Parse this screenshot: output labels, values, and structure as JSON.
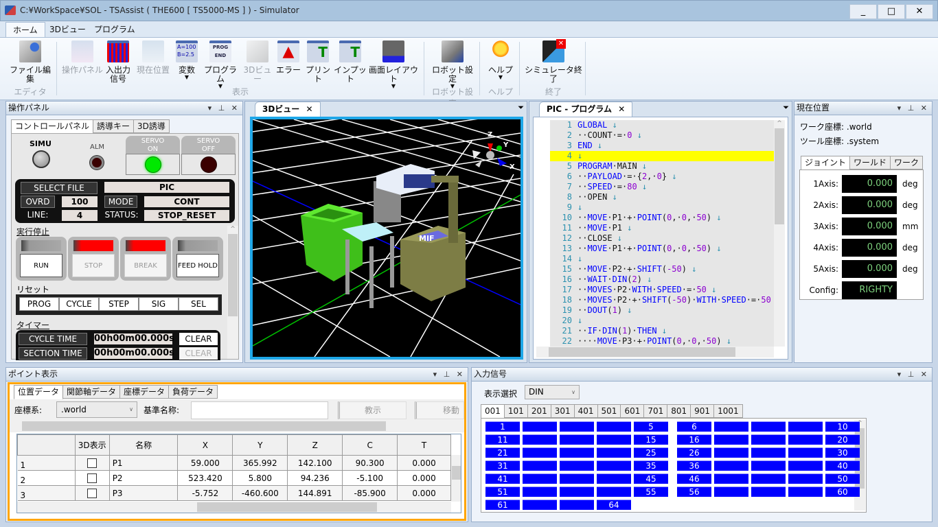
{
  "window": {
    "title": "C:¥WorkSpace¥SOL   - TSAssist ( THE600 [ TS5000-MS ] )   - Simulator",
    "controls": {
      "minimize": "_",
      "maximize": "□",
      "close": "✕"
    }
  },
  "ribbon": {
    "tabs": [
      "ホーム",
      "3Dビュー",
      "プログラム"
    ],
    "active_tab": "ホーム",
    "buttons": {
      "file_edit": "ファイル編集",
      "op_panel": "操作パネル",
      "io_signal_1": "入出力",
      "io_signal_2": "信号",
      "current_pos": "現在位置",
      "variables": "変数",
      "program": "プログラム",
      "view3d": "3Dビュー",
      "error": "エラー",
      "print": "プリント",
      "input": "インプット",
      "layout": "画面レイアウト",
      "robot_settings": "ロボット設定",
      "help": "ヘルプ",
      "sim_exit": "シミュレータ終了"
    },
    "groups": {
      "editor": "エディタ",
      "display": "表示",
      "robot_settings": "ロボット設定",
      "help": "ヘルプ",
      "exit": "終了"
    }
  },
  "control_panel": {
    "title": "操作パネル",
    "tabs": [
      "コントロールパネル",
      "誘導キー",
      "3D誘導"
    ],
    "simu_label": "SIMU",
    "alm_label": "ALM",
    "servo_on": {
      "line1": "SERVO",
      "line2": "ON",
      "lamp_color": "#00e000"
    },
    "servo_off": {
      "line1": "SERVO",
      "line2": "OFF",
      "lamp_color": "#3a0000"
    },
    "select_file_label": "SELECT FILE",
    "select_file_value": "PIC",
    "ovrd_label": "OVRD",
    "ovrd_value": "100",
    "mode_label": "MODE",
    "mode_value": "CONT",
    "line_label": "LINE:",
    "line_value": "4",
    "status_label": "STATUS:",
    "status_value": "STOP_RESET",
    "exec_stop_title": "実行停止",
    "run_buttons": [
      {
        "label": "RUN",
        "lamp": "off",
        "enabled": true
      },
      {
        "label": "STOP",
        "lamp": "red",
        "enabled": false
      },
      {
        "label": "BREAK",
        "lamp": "red",
        "enabled": false
      },
      {
        "label": "FEED HOLD",
        "lamp": "off",
        "enabled": true
      }
    ],
    "reset_title": "リセット",
    "reset_buttons": [
      "PROG",
      "CYCLE",
      "STEP",
      "SIG",
      "SEL"
    ],
    "timer_title": "タイマー",
    "cycle_time_label": "CYCLE TIME",
    "cycle_time_value": "00h00m00.000s",
    "section_time_label": "SECTION TIME",
    "section_time_value": "00h00m00.000s",
    "clear_label": "CLEAR"
  },
  "view3d": {
    "tab": "3Dビュー",
    "close": "✕",
    "overlay_label": "MIF",
    "gizmo": {
      "z": "Z",
      "y": "Y",
      "x": "X"
    }
  },
  "program": {
    "tab": "PIC - プログラム",
    "close": "✕",
    "highlight_line": 4,
    "lines": [
      [
        {
          "t": "GLOBAL",
          "c": "kw"
        },
        {
          "t": " ↓",
          "c": "ret"
        }
      ],
      [
        {
          "t": "··COUNT·=·",
          "c": "plain"
        },
        {
          "t": "0",
          "c": "num"
        },
        {
          "t": " ↓",
          "c": "ret"
        }
      ],
      [
        {
          "t": "END",
          "c": "kw"
        },
        {
          "t": " ↓",
          "c": "ret"
        }
      ],
      [
        {
          "t": "↓",
          "c": "ret"
        }
      ],
      [
        {
          "t": "PROGRAM",
          "c": "kw"
        },
        {
          "t": "·MAIN",
          "c": "plain"
        },
        {
          "t": " ↓",
          "c": "ret"
        }
      ],
      [
        {
          "t": "··",
          "c": "plain"
        },
        {
          "t": "PAYLOAD",
          "c": "kw"
        },
        {
          "t": "·=·{",
          "c": "plain"
        },
        {
          "t": "2",
          "c": "num"
        },
        {
          "t": ",·",
          "c": "plain"
        },
        {
          "t": "0",
          "c": "num"
        },
        {
          "t": "}",
          "c": "plain"
        },
        {
          "t": " ↓",
          "c": "ret"
        }
      ],
      [
        {
          "t": "··",
          "c": "plain"
        },
        {
          "t": "SPEED",
          "c": "kw"
        },
        {
          "t": "·=·",
          "c": "plain"
        },
        {
          "t": "80",
          "c": "num"
        },
        {
          "t": " ↓",
          "c": "ret"
        }
      ],
      [
        {
          "t": "··OPEN",
          "c": "plain"
        },
        {
          "t": " ↓",
          "c": "ret"
        }
      ],
      [
        {
          "t": "↓",
          "c": "ret"
        }
      ],
      [
        {
          "t": "··",
          "c": "plain"
        },
        {
          "t": "MOVE",
          "c": "kw"
        },
        {
          "t": "·P1·+·",
          "c": "plain"
        },
        {
          "t": "POINT",
          "c": "kw"
        },
        {
          "t": "(",
          "c": "plain"
        },
        {
          "t": "0",
          "c": "num"
        },
        {
          "t": ",·",
          "c": "plain"
        },
        {
          "t": "0",
          "c": "num"
        },
        {
          "t": ",·",
          "c": "plain"
        },
        {
          "t": "50",
          "c": "num"
        },
        {
          "t": ")",
          "c": "plain"
        },
        {
          "t": " ↓",
          "c": "ret"
        }
      ],
      [
        {
          "t": "··",
          "c": "plain"
        },
        {
          "t": "MOVE",
          "c": "kw"
        },
        {
          "t": "·P1",
          "c": "plain"
        },
        {
          "t": " ↓",
          "c": "ret"
        }
      ],
      [
        {
          "t": "··CLOSE",
          "c": "plain"
        },
        {
          "t": " ↓",
          "c": "ret"
        }
      ],
      [
        {
          "t": "··",
          "c": "plain"
        },
        {
          "t": "MOVE",
          "c": "kw"
        },
        {
          "t": "·P1·+·",
          "c": "plain"
        },
        {
          "t": "POINT",
          "c": "kw"
        },
        {
          "t": "(",
          "c": "plain"
        },
        {
          "t": "0",
          "c": "num"
        },
        {
          "t": ",·",
          "c": "plain"
        },
        {
          "t": "0",
          "c": "num"
        },
        {
          "t": ",·",
          "c": "plain"
        },
        {
          "t": "50",
          "c": "num"
        },
        {
          "t": ")",
          "c": "plain"
        },
        {
          "t": " ↓",
          "c": "ret"
        }
      ],
      [
        {
          "t": "↓",
          "c": "ret"
        }
      ],
      [
        {
          "t": "··",
          "c": "plain"
        },
        {
          "t": "MOVE",
          "c": "kw"
        },
        {
          "t": "·P2·+·",
          "c": "plain"
        },
        {
          "t": "SHIFT",
          "c": "kw"
        },
        {
          "t": "(",
          "c": "plain"
        },
        {
          "t": "-50",
          "c": "num"
        },
        {
          "t": ")",
          "c": "plain"
        },
        {
          "t": " ↓",
          "c": "ret"
        }
      ],
      [
        {
          "t": "··",
          "c": "plain"
        },
        {
          "t": "WAIT",
          "c": "kw"
        },
        {
          "t": "·",
          "c": "plain"
        },
        {
          "t": "DIN",
          "c": "kw"
        },
        {
          "t": "(",
          "c": "plain"
        },
        {
          "t": "2",
          "c": "num"
        },
        {
          "t": ")",
          "c": "plain"
        },
        {
          "t": " ↓",
          "c": "ret"
        }
      ],
      [
        {
          "t": "··",
          "c": "plain"
        },
        {
          "t": "MOVES",
          "c": "kw"
        },
        {
          "t": "·P2·",
          "c": "plain"
        },
        {
          "t": "WITH",
          "c": "kw"
        },
        {
          "t": "·",
          "c": "plain"
        },
        {
          "t": "SPEED",
          "c": "kw"
        },
        {
          "t": "·=·",
          "c": "plain"
        },
        {
          "t": "50",
          "c": "num"
        },
        {
          "t": " ↓",
          "c": "ret"
        }
      ],
      [
        {
          "t": "··",
          "c": "plain"
        },
        {
          "t": "MOVES",
          "c": "kw"
        },
        {
          "t": "·P2·+·",
          "c": "plain"
        },
        {
          "t": "SHIFT",
          "c": "kw"
        },
        {
          "t": "(",
          "c": "plain"
        },
        {
          "t": "-50",
          "c": "num"
        },
        {
          "t": ")·",
          "c": "plain"
        },
        {
          "t": "WITH",
          "c": "kw"
        },
        {
          "t": "·",
          "c": "plain"
        },
        {
          "t": "SPEED",
          "c": "kw"
        },
        {
          "t": "·=·",
          "c": "plain"
        },
        {
          "t": "50",
          "c": "num"
        }
      ],
      [
        {
          "t": "··",
          "c": "plain"
        },
        {
          "t": "DOUT",
          "c": "kw"
        },
        {
          "t": "(",
          "c": "plain"
        },
        {
          "t": "1",
          "c": "num"
        },
        {
          "t": ")",
          "c": "plain"
        },
        {
          "t": " ↓",
          "c": "ret"
        }
      ],
      [
        {
          "t": "↓",
          "c": "ret"
        }
      ],
      [
        {
          "t": "··",
          "c": "plain"
        },
        {
          "t": "IF",
          "c": "kw"
        },
        {
          "t": "·",
          "c": "plain"
        },
        {
          "t": "DIN",
          "c": "kw"
        },
        {
          "t": "(",
          "c": "plain"
        },
        {
          "t": "1",
          "c": "num"
        },
        {
          "t": ")·",
          "c": "plain"
        },
        {
          "t": "THEN",
          "c": "kw"
        },
        {
          "t": " ↓",
          "c": "ret"
        }
      ],
      [
        {
          "t": "····",
          "c": "plain"
        },
        {
          "t": "MOVE",
          "c": "kw"
        },
        {
          "t": "·P3·+·",
          "c": "plain"
        },
        {
          "t": "POINT",
          "c": "kw"
        },
        {
          "t": "(",
          "c": "plain"
        },
        {
          "t": "0",
          "c": "num"
        },
        {
          "t": ",·",
          "c": "plain"
        },
        {
          "t": "0",
          "c": "num"
        },
        {
          "t": ",·",
          "c": "plain"
        },
        {
          "t": "50",
          "c": "num"
        },
        {
          "t": ")",
          "c": "plain"
        },
        {
          "t": " ↓",
          "c": "ret"
        }
      ]
    ]
  },
  "current_position": {
    "title": "現在位置",
    "work_coord_label": "ワーク座標:",
    "work_coord_value": ".world",
    "tool_coord_label": "ツール座標:",
    "tool_coord_value": ".system",
    "tabs": [
      "ジョイント",
      "ワールド",
      "ワーク"
    ],
    "axes": [
      {
        "label": "1Axis:",
        "value": "0.000",
        "unit": "deg"
      },
      {
        "label": "2Axis:",
        "value": "0.000",
        "unit": "deg"
      },
      {
        "label": "3Axis:",
        "value": "0.000",
        "unit": "mm"
      },
      {
        "label": "4Axis:",
        "value": "0.000",
        "unit": "deg"
      },
      {
        "label": "5Axis:",
        "value": "0.000",
        "unit": "deg"
      }
    ],
    "config_label": "Config:",
    "config_value": "RIGHTY"
  },
  "point_display": {
    "title": "ポイント表示",
    "tabs": [
      "位置データ",
      "関節軸データ",
      "座標データ",
      "負荷データ"
    ],
    "coord_label": "座標系:",
    "coord_value": ".world",
    "base_name_label": "基準名称:",
    "base_name_value": "",
    "teach_button": "教示",
    "move_button": "移動",
    "columns": [
      "",
      "3D表示",
      "名称",
      "X",
      "Y",
      "Z",
      "C",
      "T"
    ],
    "rows": [
      {
        "no": "1",
        "show3d": false,
        "name": "P1",
        "x": "59.000",
        "y": "365.992",
        "z": "142.100",
        "c": "90.300",
        "t": "0.000"
      },
      {
        "no": "2",
        "show3d": false,
        "name": "P2",
        "x": "523.420",
        "y": "5.800",
        "z": "94.236",
        "c": "-5.100",
        "t": "0.000"
      },
      {
        "no": "3",
        "show3d": false,
        "name": "P3",
        "x": "-5.752",
        "y": "-460.600",
        "z": "144.891",
        "c": "-85.900",
        "t": "0.000"
      }
    ]
  },
  "input_signal": {
    "title": "入力信号",
    "select_label": "表示選択",
    "select_value": "DIN",
    "tabs": [
      "001",
      "101",
      "201",
      "301",
      "401",
      "501",
      "601",
      "701",
      "801",
      "901",
      "1001"
    ],
    "active_tab": "001",
    "signal_count": 64,
    "off_color": "#0000ff"
  }
}
